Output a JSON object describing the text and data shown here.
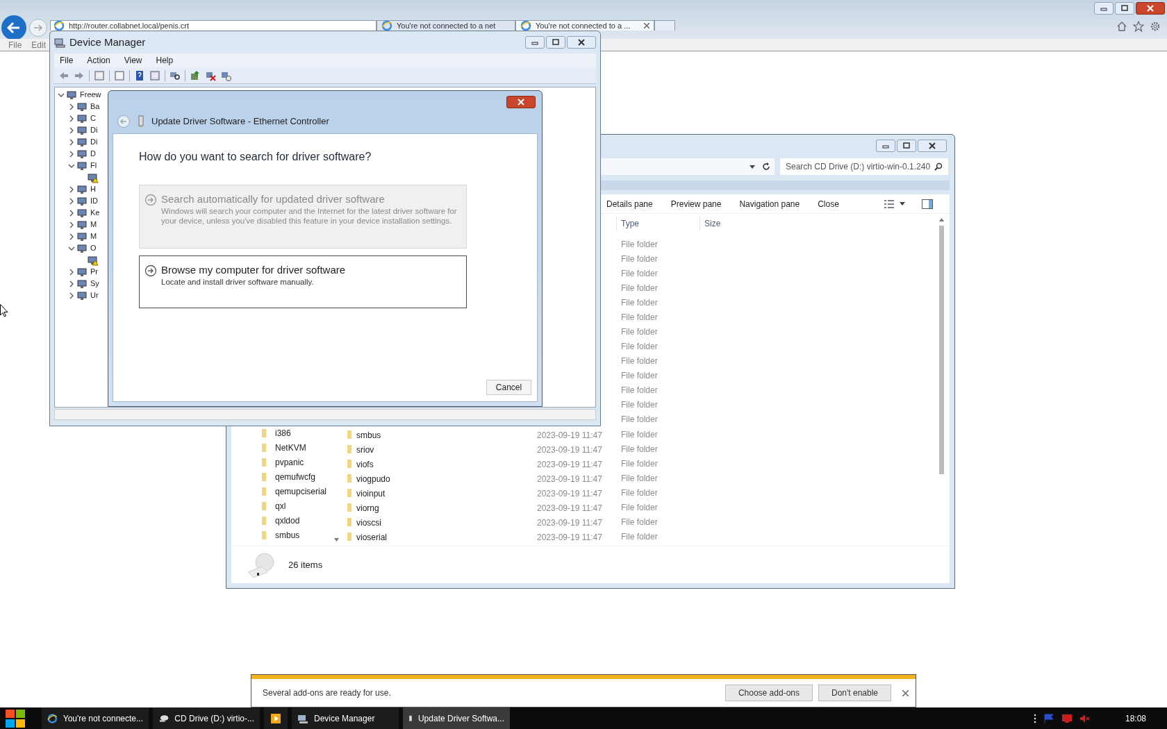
{
  "browser": {
    "address": "http://router.collabnet.local/penis.crt",
    "menu": [
      "File",
      "Edit"
    ],
    "tabs": [
      {
        "title": "You're not connected to a net",
        "selected": false
      },
      {
        "title": "You're not connected to a ...",
        "selected": true
      }
    ]
  },
  "device_manager": {
    "title": "Device Manager",
    "menu": [
      "File",
      "Action",
      "View",
      "Help"
    ],
    "tree": {
      "label": "Freew",
      "expanded": true,
      "children": [
        {
          "label": "Ba",
          "expanded": false
        },
        {
          "label": "C",
          "expanded": false
        },
        {
          "label": "Di",
          "expanded": false
        },
        {
          "label": "Di",
          "expanded": false
        },
        {
          "label": "D",
          "expanded": false
        },
        {
          "label": "Fl",
          "expanded": true,
          "children": [
            {
              "warning": true
            }
          ]
        },
        {
          "label": "H",
          "expanded": false
        },
        {
          "label": "ID",
          "expanded": false
        },
        {
          "label": "Ke",
          "expanded": false
        },
        {
          "label": "M",
          "expanded": false
        },
        {
          "label": "M",
          "expanded": false
        },
        {
          "label": "O",
          "expanded": true,
          "children": [
            {
              "warning": true
            }
          ]
        },
        {
          "label": "Pr",
          "expanded": false
        },
        {
          "label": "Sy",
          "expanded": false
        },
        {
          "label": "Ur",
          "expanded": false
        }
      ]
    }
  },
  "update_dialog": {
    "title": "Update Driver Software - Ethernet Controller",
    "question": "How do you want to search for driver software?",
    "options": [
      {
        "title": "Search automatically for updated driver software",
        "description": "Windows will search your computer and the Internet for the latest driver software for your device, unless you've disabled this feature in your device installation settings.",
        "disabled": true
      },
      {
        "title": "Browse my computer for driver software",
        "description": "Locate and install driver software manually.",
        "disabled": false
      }
    ],
    "cancel": "Cancel"
  },
  "explorer": {
    "search_placeholder": "Search CD Drive (D:) virtio-win-0.1.240",
    "toolbar": [
      "Details pane",
      "Preview pane",
      "Navigation pane",
      "Close"
    ],
    "columns": [
      "Type",
      "Size"
    ],
    "nav_items": [
      "i386",
      "NetKVM",
      "pvpanic",
      "qemufwcfg",
      "qemupciserial",
      "qxl",
      "qxldod",
      "smbus"
    ],
    "rows": [
      {
        "type": "File folder"
      },
      {
        "type": "File folder"
      },
      {
        "type": "File folder"
      },
      {
        "type": "File folder"
      },
      {
        "type": "File folder"
      },
      {
        "type": "File folder"
      },
      {
        "type": "File folder"
      },
      {
        "type": "File folder"
      },
      {
        "type": "File folder"
      },
      {
        "type": "File folder"
      },
      {
        "type": "File folder"
      },
      {
        "type": "File folder"
      },
      {
        "type": "File folder"
      },
      {
        "name": "smbus",
        "date": "2023-09-19 11:47",
        "type": "File folder"
      },
      {
        "name": "sriov",
        "date": "2023-09-19 11:47",
        "type": "File folder"
      },
      {
        "name": "viofs",
        "date": "2023-09-19 11:47",
        "type": "File folder"
      },
      {
        "name": "viogpudo",
        "date": "2023-09-19 11:47",
        "type": "File folder"
      },
      {
        "name": "vioinput",
        "date": "2023-09-19 11:47",
        "type": "File folder"
      },
      {
        "name": "viorng",
        "date": "2023-09-19 11:47",
        "type": "File folder"
      },
      {
        "name": "vioscsi",
        "date": "2023-09-19 11:47",
        "type": "File folder"
      },
      {
        "name": "vioserial",
        "date": "2023-09-19 11:47",
        "type": "File folder"
      }
    ],
    "status": "26 items"
  },
  "notification": {
    "message": "Several add-ons are ready for use.",
    "buttons": [
      "Choose add-ons",
      "Don't enable"
    ]
  },
  "taskbar": {
    "items": [
      {
        "kind": "ie",
        "label": "You're not connecte...",
        "selected": false
      },
      {
        "kind": "drive",
        "label": "CD Drive (D:) virtio-...",
        "selected": false
      },
      {
        "kind": "media",
        "selected": false
      },
      {
        "kind": "devmgr",
        "label": "Device Manager",
        "selected": false
      },
      {
        "kind": "driver",
        "label": "Update Driver Softwa...",
        "selected": true
      }
    ],
    "clock": "18:08"
  }
}
